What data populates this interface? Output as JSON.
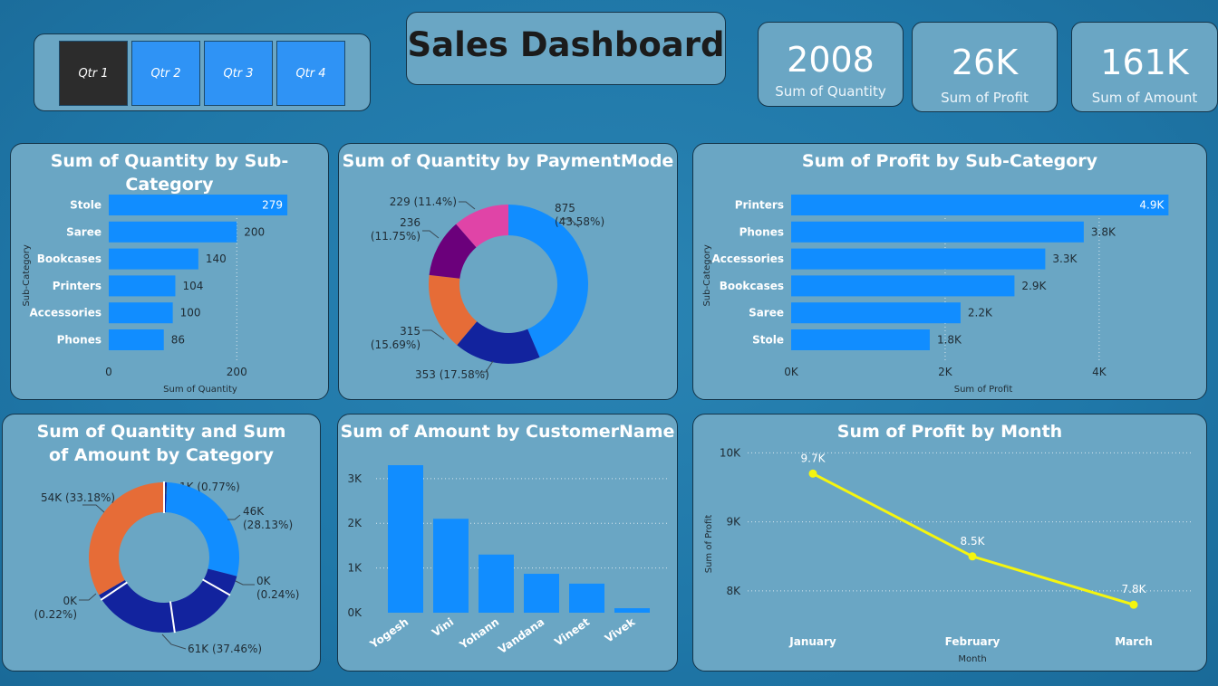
{
  "slicer": {
    "items": [
      "Qtr 1",
      "Qtr 2",
      "Qtr 3",
      "Qtr 4"
    ],
    "selected": 0
  },
  "title": "Sales Dashboard",
  "kpis": [
    {
      "value": "2008",
      "label": "Sum of Quantity"
    },
    {
      "value": "26K",
      "label": "Sum of Profit"
    },
    {
      "value": "161K",
      "label": "Sum of Amount"
    }
  ],
  "colors": {
    "bar": "#118dff",
    "navy": "#12239e",
    "orange": "#e66c37",
    "purple": "#6b007b",
    "pink": "#e044a7",
    "yellow": "#f5f50f",
    "panel": "#6aa6c4",
    "slicer_selected": "#2c2c2c"
  },
  "chart_data": [
    {
      "type": "bar",
      "orientation": "horizontal",
      "title": "Sum of Quantity by Sub-Category",
      "xlabel": "Sum of Quantity",
      "ylabel": "Sub-Category",
      "categories": [
        "Stole",
        "Saree",
        "Bookcases",
        "Printers",
        "Accessories",
        "Phones"
      ],
      "values": [
        279,
        200,
        140,
        104,
        100,
        86
      ],
      "data_labels": [
        "279",
        "200",
        "140",
        "104",
        "100",
        "86"
      ],
      "xlim": [
        0,
        286
      ],
      "xticks": [
        0,
        200
      ],
      "xtick_labels": [
        "0",
        "200"
      ]
    },
    {
      "type": "pie",
      "donut": true,
      "title": "Sum of Quantity by PaymentMode",
      "values": [
        875,
        353,
        315,
        236,
        229
      ],
      "labels": [
        "875\n(43.58%)",
        "353 (17.58%)",
        "315\n(15.69%)",
        "236\n(11.75%)",
        "229 (11.4%)"
      ],
      "colors": [
        "#118dff",
        "#12239e",
        "#e66c37",
        "#6b007b",
        "#e044a7"
      ]
    },
    {
      "type": "bar",
      "orientation": "horizontal",
      "title": "Sum of Profit by Sub-Category",
      "xlabel": "Sum of Profit",
      "ylabel": "Sub-Category",
      "categories": [
        "Printers",
        "Phones",
        "Accessories",
        "Bookcases",
        "Saree",
        "Stole"
      ],
      "values": [
        4900,
        3800,
        3300,
        2900,
        2200,
        1800
      ],
      "data_labels": [
        "4.9K",
        "3.8K",
        "3.3K",
        "2.9K",
        "2.2K",
        "1.8K"
      ],
      "xlim": [
        0,
        4990
      ],
      "xticks": [
        0,
        2000,
        4000
      ],
      "xtick_labels": [
        "0K",
        "2K",
        "4K"
      ]
    },
    {
      "type": "pie",
      "donut": true,
      "title": "Sum of Quantity and Sum of Amount by Category",
      "values": [
        1,
        46,
        0,
        61,
        0,
        54
      ],
      "labels": [
        "1K (0.77%)",
        "46K\n(28.13%)",
        "0K\n(0.24%)",
        "61K (37.46%)",
        "0K\n(0.22%)",
        "54K (33.18%)"
      ],
      "colors": [
        "#12239e",
        "#118dff",
        "#12239e",
        "#12239e",
        "#e66c37",
        "#e66c37"
      ]
    },
    {
      "type": "bar",
      "title": "Sum of Amount by CustomerName",
      "categories": [
        "Yogesh",
        "Vini",
        "Yohann",
        "Vandana",
        "Vineet",
        "Vivek"
      ],
      "values": [
        3300,
        2100,
        1300,
        870,
        650,
        100
      ],
      "ylim": [
        0,
        3300
      ],
      "yticks": [
        0,
        1000,
        2000,
        3000
      ],
      "ytick_labels": [
        "0K",
        "1K",
        "2K",
        "3K"
      ]
    },
    {
      "type": "line",
      "title": "Sum of Profit by Month",
      "xlabel": "Month",
      "ylabel": "Sum of Profit",
      "categories": [
        "January",
        "February",
        "March"
      ],
      "values": [
        9700,
        8500,
        7800
      ],
      "data_labels": [
        "9.7K",
        "8.5K",
        "7.8K"
      ],
      "ylim": [
        7500,
        10150
      ],
      "yticks": [
        8000,
        9000,
        10000
      ],
      "ytick_labels": [
        "8K",
        "9K",
        "10K"
      ]
    }
  ]
}
